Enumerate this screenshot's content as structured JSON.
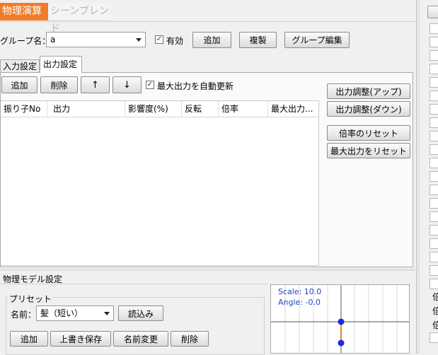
{
  "top_tabs": {
    "active": "物理演算",
    "inactive": "シーンブレンド"
  },
  "group": {
    "label": "グループ名：",
    "value": "a",
    "enabled_label": "有効",
    "enabled_check": "✓",
    "add": "追加",
    "duplicate": "複製",
    "edit": "グループ編集"
  },
  "sub_tabs": {
    "input": "入力設定",
    "output": "出力設定"
  },
  "output": {
    "add": "追加",
    "delete": "削除",
    "up": "↑",
    "down": "↓",
    "auto_update_label": "最大出力を自動更新",
    "auto_update_check": "✓",
    "columns": [
      "振り子No",
      "出力",
      "影響度(%)",
      "反転",
      "倍率",
      "最大出力..."
    ]
  },
  "side_buttons": {
    "adjust_up": "出力調整(アップ)",
    "adjust_down": "出力調整(ダウン)",
    "reset_ratio": "倍率のリセット",
    "reset_max": "最大出力をリセット"
  },
  "physics_model": {
    "title": "物理モデル設定",
    "preset": {
      "title": "プリセット",
      "name_label": "名前：",
      "name_value": "髪（短い）",
      "load": "読込み",
      "add": "追加",
      "overwrite": "上書き保存",
      "rename": "名前変更",
      "delete": "削除"
    },
    "preview": {
      "scale": "Scale: 10.0",
      "angle": "Angle: -0.0"
    }
  },
  "right_edge_glyphs": [
    "倍",
    "倍",
    "倍"
  ],
  "colors": {
    "active_tab": "#f07d2a",
    "inactive_tab_text": "#b5b5b5",
    "preview_text": "#1e46c8",
    "pendulum": "#1a2be0",
    "pendulum_line": "#f07d2a"
  }
}
